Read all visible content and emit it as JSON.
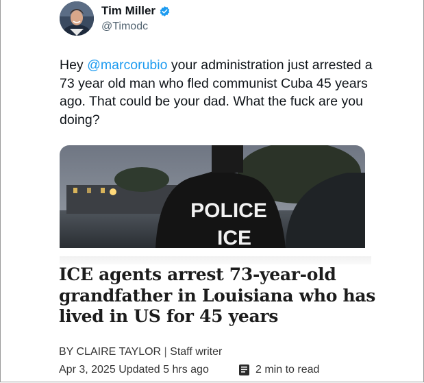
{
  "author": {
    "display_name": "Tim Miller",
    "handle": "@Timodc",
    "verified": true,
    "badge_color": "#1d9bf0"
  },
  "tweet": {
    "prefix": "Hey ",
    "mention": "@marcorubio",
    "body": " your administration just arrested a 73 year old man who fled communist Cuba 45 years ago. That could be your dad. What the fuck are you doing?"
  },
  "card": {
    "image_text_line1": "POLICE",
    "image_text_line2": "ICE",
    "headline": "ICE agents arrest 73-year-old grandfather in Louisiana who has lived in US for 45 years",
    "byline_author": "BY CLAIRE TAYLOR",
    "byline_separator": "|",
    "byline_role": "Staff writer",
    "date": "Apr 3, 2025",
    "updated": "Updated 5 hrs ago",
    "read_time": "2 min to read"
  },
  "colors": {
    "link": "#1d9bf0",
    "text": "#0f1419",
    "muted": "#536471"
  },
  "icons": [
    "verified-badge-icon",
    "book-icon"
  ]
}
